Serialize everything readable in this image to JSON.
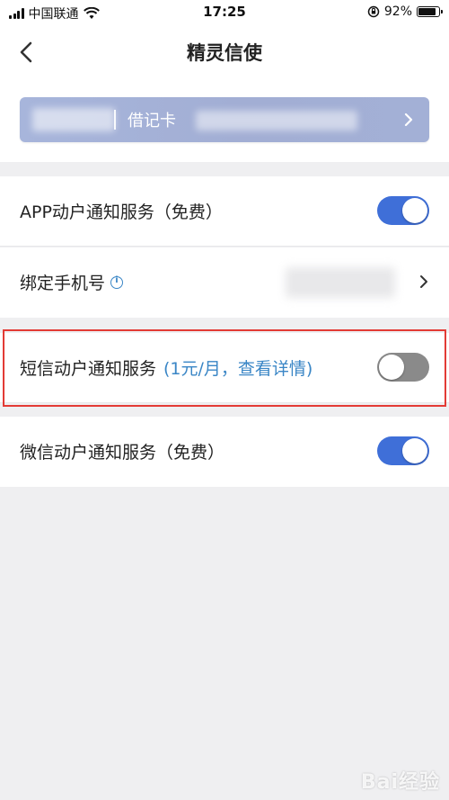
{
  "status_bar": {
    "carrier": "中国联通",
    "time": "17:25",
    "battery": "92%",
    "battery_level": 0.92
  },
  "header": {
    "title": "精灵信使"
  },
  "card": {
    "type_label": "借记卡"
  },
  "settings": {
    "app_notice": {
      "label": "APP动户通知服务（免费）",
      "enabled": true
    },
    "bind_phone": {
      "label": "绑定手机号"
    },
    "sms_notice": {
      "label": "短信动户通知服务",
      "link": "(1元/月，查看详情)",
      "enabled": false
    },
    "wechat_notice": {
      "label": "微信动户通知服务（免费）",
      "enabled": true
    }
  },
  "colors": {
    "toggle_on": "#3f6fd8",
    "toggle_off": "#8a8a8a",
    "link": "#3a86c6",
    "highlight": "#e33b35"
  },
  "icons": [
    "signal-icon",
    "wifi-icon",
    "orientation-lock-icon",
    "battery-icon",
    "back-arrow-icon",
    "chevron-right-icon",
    "info-icon"
  ],
  "watermark": "Bai经验"
}
